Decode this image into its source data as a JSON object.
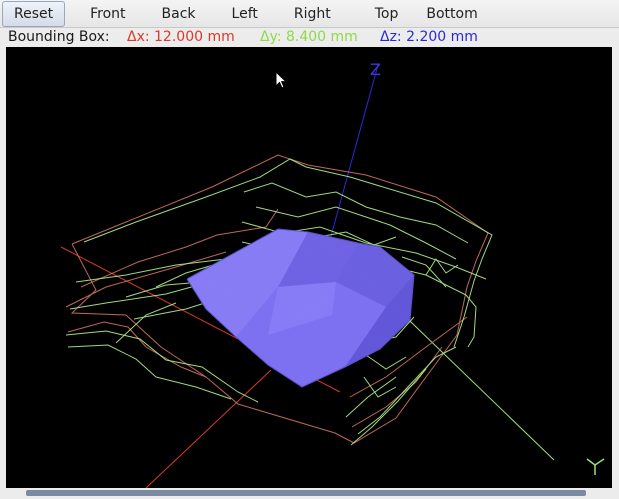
{
  "toolbar": {
    "buttons": [
      "Reset",
      "Front",
      "Back",
      "Left",
      "Right",
      "Top",
      "Bottom"
    ],
    "active": "Reset"
  },
  "bounding_box": {
    "label": "Bounding Box:",
    "dx": "Δx: 12.000 mm",
    "dy": "Δy: 8.400 mm",
    "dz": "Δz: 2.200 mm"
  },
  "viewport": {
    "axis_label_z": "Z",
    "background": "#000000",
    "colors": {
      "x_axis": "#d83a2a",
      "y_axis": "#9be070",
      "z_axis": "#2a2ad8",
      "mesh": "#7a6cf0",
      "wire_green": "#b4f08a",
      "wire_red": "#e07a6a"
    }
  }
}
